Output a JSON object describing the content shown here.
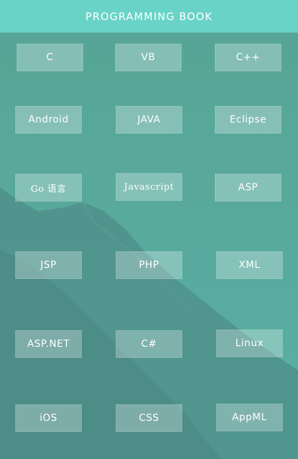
{
  "header": {
    "title": "PROGRAMMING BOOK"
  },
  "books": [
    {
      "label": "C"
    },
    {
      "label": "VB"
    },
    {
      "label": "C++"
    },
    {
      "label": "Android"
    },
    {
      "label": "JAVA"
    },
    {
      "label": "Eclipse"
    },
    {
      "label": "Go 语言"
    },
    {
      "label": "Javascript"
    },
    {
      "label": "ASP"
    },
    {
      "label": "JSP"
    },
    {
      "label": "PHP"
    },
    {
      "label": "XML"
    },
    {
      "label": "ASP.NET"
    },
    {
      "label": "C#"
    },
    {
      "label": "Linux"
    },
    {
      "label": "iOS"
    },
    {
      "label": "CSS"
    },
    {
      "label": "AppML"
    }
  ],
  "colors": {
    "header": "#6ad3c8",
    "background": "#5aa99c",
    "mountain": "#4b8a85"
  }
}
